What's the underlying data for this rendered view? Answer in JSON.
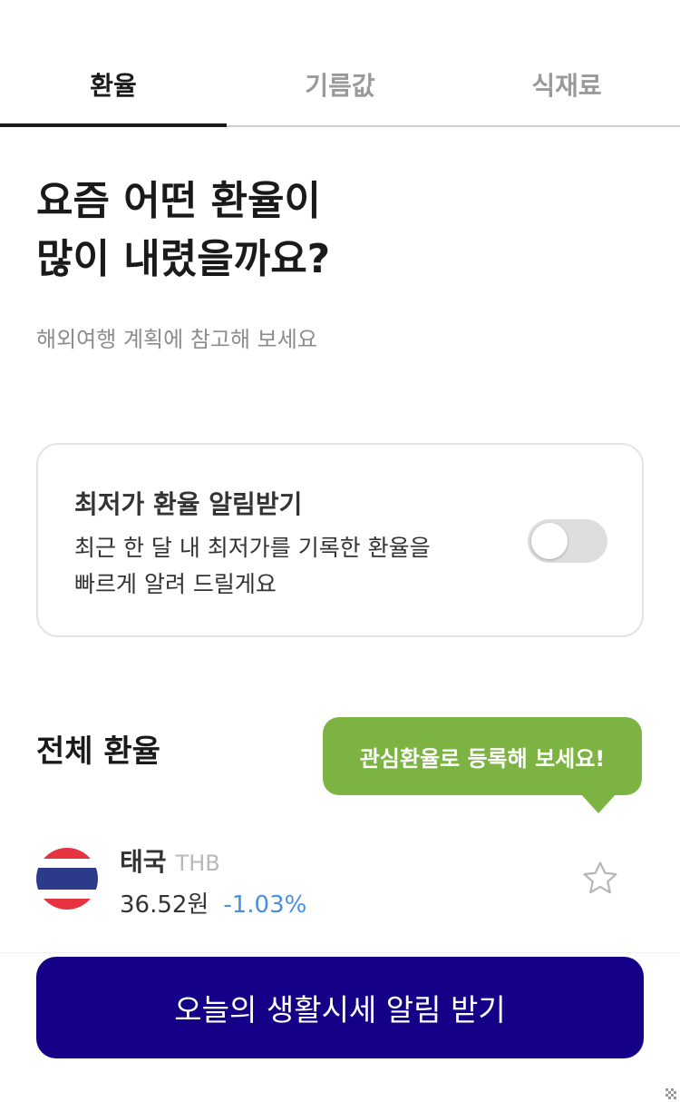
{
  "tabs": [
    {
      "label": "환율",
      "active": true
    },
    {
      "label": "기름값",
      "active": false
    },
    {
      "label": "식재료",
      "active": false
    }
  ],
  "headline": {
    "line1": "요즘 어떤 환율이",
    "line2": "많이 내렸을까요?"
  },
  "subline": "해외여행 계획에 참고해 보세요",
  "alert": {
    "title": "최저가 환율 알림받기",
    "desc_line1": "최근 한 달 내 최저가를 기록한 환율을",
    "desc_line2": "빠르게 알려 드릴게요",
    "toggle_on": false
  },
  "section": {
    "title": "전체 환율",
    "tooltip": "관심환율로 등록해 보세요!"
  },
  "currencies": [
    {
      "name": "태국",
      "code": "THB",
      "price": "36.52원",
      "change": "-1.03%",
      "flag_icon": "thailand-flag-icon",
      "favorite": false
    }
  ],
  "cta": {
    "label": "오늘의 생활시세 알림 받기"
  },
  "colors": {
    "accent_green": "#7cb342",
    "cta_navy": "#150088",
    "change_blue": "#4a8fe0"
  }
}
